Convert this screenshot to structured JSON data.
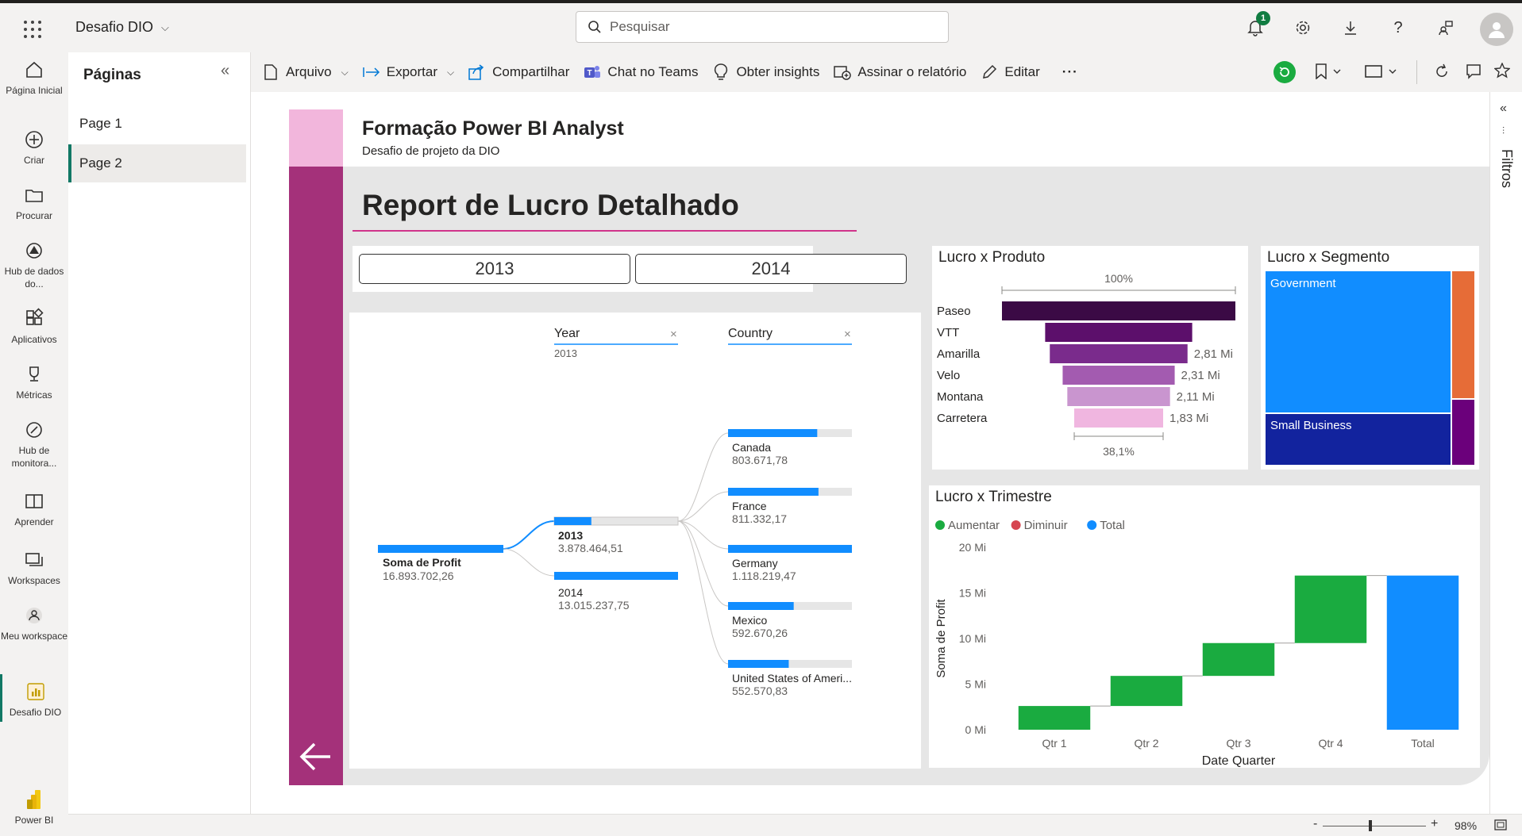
{
  "header": {
    "workspace_name": "Desafio DIO",
    "search_placeholder": "Pesquisar",
    "notifications_count": "1"
  },
  "rail": {
    "items": [
      {
        "label": "Página Inicial"
      },
      {
        "label": "Criar"
      },
      {
        "label": "Procurar"
      },
      {
        "label": "Hub de dados do..."
      },
      {
        "label": "Aplicativos"
      },
      {
        "label": "Métricas"
      },
      {
        "label": "Hub de monitora..."
      },
      {
        "label": "Aprender"
      },
      {
        "label": "Workspaces"
      },
      {
        "label": "Meu workspace"
      },
      {
        "label": "Desafio DIO"
      }
    ],
    "brand": "Power BI"
  },
  "pages": {
    "title": "Páginas",
    "items": [
      {
        "label": "Page 1"
      },
      {
        "label": "Page 2"
      }
    ],
    "active": "Page 2"
  },
  "toolbar": {
    "arquivo": "Arquivo",
    "exportar": "Exportar",
    "compartilhar": "Compartilhar",
    "chat_teams": "Chat no Teams",
    "insights": "Obter insights",
    "assinar": "Assinar o relatório",
    "editar": "Editar",
    "more": "···"
  },
  "report": {
    "title": "Formação Power BI Analyst",
    "subtitle": "Desafio de projeto da DIO",
    "main_title": "Report de Lucro Detalhado",
    "slicer": [
      "2013",
      "2014"
    ]
  },
  "decomp": {
    "level1_header": "Year",
    "level1_sub": "2013",
    "level2_header": "Country",
    "root": {
      "label": "Soma de Profit",
      "value": "16.893.702,26"
    },
    "years": [
      {
        "label": "2013",
        "value": "3.878.464,51",
        "fraction": 0.3
      },
      {
        "label": "2014",
        "value": "13.015.237,75",
        "fraction": 1.0
      }
    ],
    "countries": [
      {
        "label": "Canada",
        "value": "803.671,78",
        "fraction": 0.72
      },
      {
        "label": "France",
        "value": "811.332,17",
        "fraction": 0.73
      },
      {
        "label": "Germany",
        "value": "1.118.219,47",
        "fraction": 1.0
      },
      {
        "label": "Mexico",
        "value": "592.670,26",
        "fraction": 0.53
      },
      {
        "label": "United States of Ameri...",
        "value": "552.570,83",
        "fraction": 0.49
      }
    ]
  },
  "visuals": {
    "funnel_title": "Lucro x Produto",
    "treemap_title": "Lucro x Segmento",
    "waterfall_title": "Lucro x Trimestre"
  },
  "treemap": {
    "segments": [
      {
        "label": "Government",
        "color": "#118dff"
      },
      {
        "label": "Small Business",
        "color": "#12239e"
      },
      {
        "label": "",
        "color": "#e66c37"
      },
      {
        "label": "",
        "color": "#6b007b"
      }
    ]
  },
  "filters": {
    "label": "Filtros"
  },
  "status": {
    "zoom": "98%"
  },
  "chart_data": [
    {
      "type": "bar",
      "subtype": "funnel",
      "title": "Lucro x Produto",
      "categories": [
        "Paseo",
        "VTT",
        "Amarilla",
        "Velo",
        "Montana",
        "Carretera"
      ],
      "relative_values": [
        1.0,
        0.63,
        0.59,
        0.48,
        0.44,
        0.381
      ],
      "data_labels": [
        "",
        "",
        "2,81 Mi",
        "2,31 Mi",
        "2,11 Mi",
        "1,83 Mi"
      ],
      "top_label": "100%",
      "bottom_label": "38,1%",
      "colors": [
        "#3b0a45",
        "#5c0f6b",
        "#7a2b8c",
        "#a35bb0",
        "#c995cf",
        "#f0b6e0"
      ]
    },
    {
      "type": "bar",
      "subtype": "waterfall",
      "title": "Lucro x Trimestre",
      "categories": [
        "Qtr 1",
        "Qtr 2",
        "Qtr 3",
        "Qtr 4",
        "Total"
      ],
      "starts": [
        0,
        2.6,
        5.9,
        9.5,
        0
      ],
      "ends": [
        2.6,
        5.9,
        9.5,
        16.9,
        16.9
      ],
      "legend": [
        "Aumentar",
        "Diminuir",
        "Total"
      ],
      "legend_colors": [
        "#1aab40",
        "#d64550",
        "#118dff"
      ],
      "xlabel": "Date Quarter",
      "ylabel": "Soma de Profit",
      "yticks": [
        "0 Mi",
        "5 Mi",
        "10 Mi",
        "15 Mi",
        "20 Mi"
      ],
      "ylim": [
        0,
        20
      ]
    }
  ]
}
